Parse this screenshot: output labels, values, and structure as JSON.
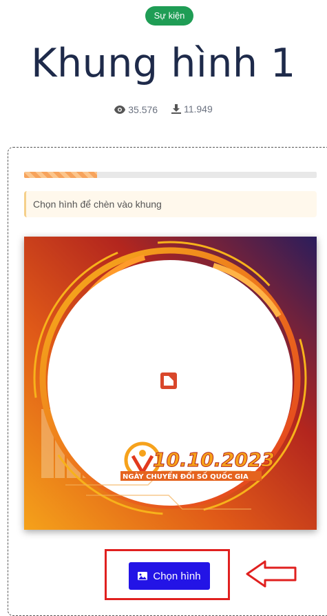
{
  "badge": "Sự kiện",
  "title": "Khung hình 1",
  "stats": {
    "views": "35.576",
    "downloads": "11.949"
  },
  "progress": {
    "fraction": 0.25
  },
  "notice": "Chọn hình để chèn vào khung",
  "frame": {
    "date": "10.10.2023",
    "subtitle": "NGÀY CHUYỂN ĐỔI SỐ QUỐC GIA"
  },
  "action": {
    "choose_label": "Chọn hình"
  },
  "colors": {
    "badge": "#1f9d55",
    "button": "#2314e6",
    "highlight": "#e0201f",
    "title": "#1e2a4a"
  }
}
